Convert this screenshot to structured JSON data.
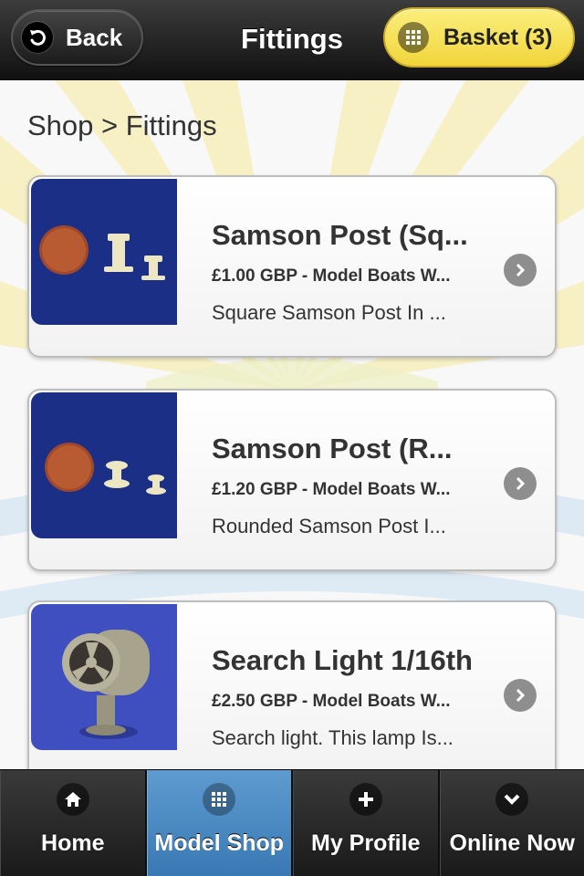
{
  "header": {
    "back_label": "Back",
    "title": "Fittings",
    "basket_label": "Basket (3)"
  },
  "breadcrumb": "Shop > Fittings",
  "products": [
    {
      "title": "Samson Post (Sq...",
      "price": "£1.00 GBP - Model Boats W...",
      "description": "Square Samson Post In ..."
    },
    {
      "title": "Samson Post (R...",
      "price": "£1.20 GBP - Model Boats W...",
      "description": "Rounded Samson Post I..."
    },
    {
      "title": "Search Light 1/16th",
      "price": "£2.50 GBP - Model Boats W...",
      "description": "Search light. This lamp Is..."
    }
  ],
  "tabs": [
    {
      "label": "Home",
      "icon": "home-icon"
    },
    {
      "label": "Model Shop",
      "icon": "grid-icon",
      "active": true
    },
    {
      "label": "My Profile",
      "icon": "plus-icon"
    },
    {
      "label": "Online Now",
      "icon": "chevron-down-icon"
    }
  ],
  "colors": {
    "header": "#1e1e1e",
    "basket": "#f6dd4f",
    "active_tab": "#4a88c2",
    "thumb_blue": "#1c2f86"
  }
}
